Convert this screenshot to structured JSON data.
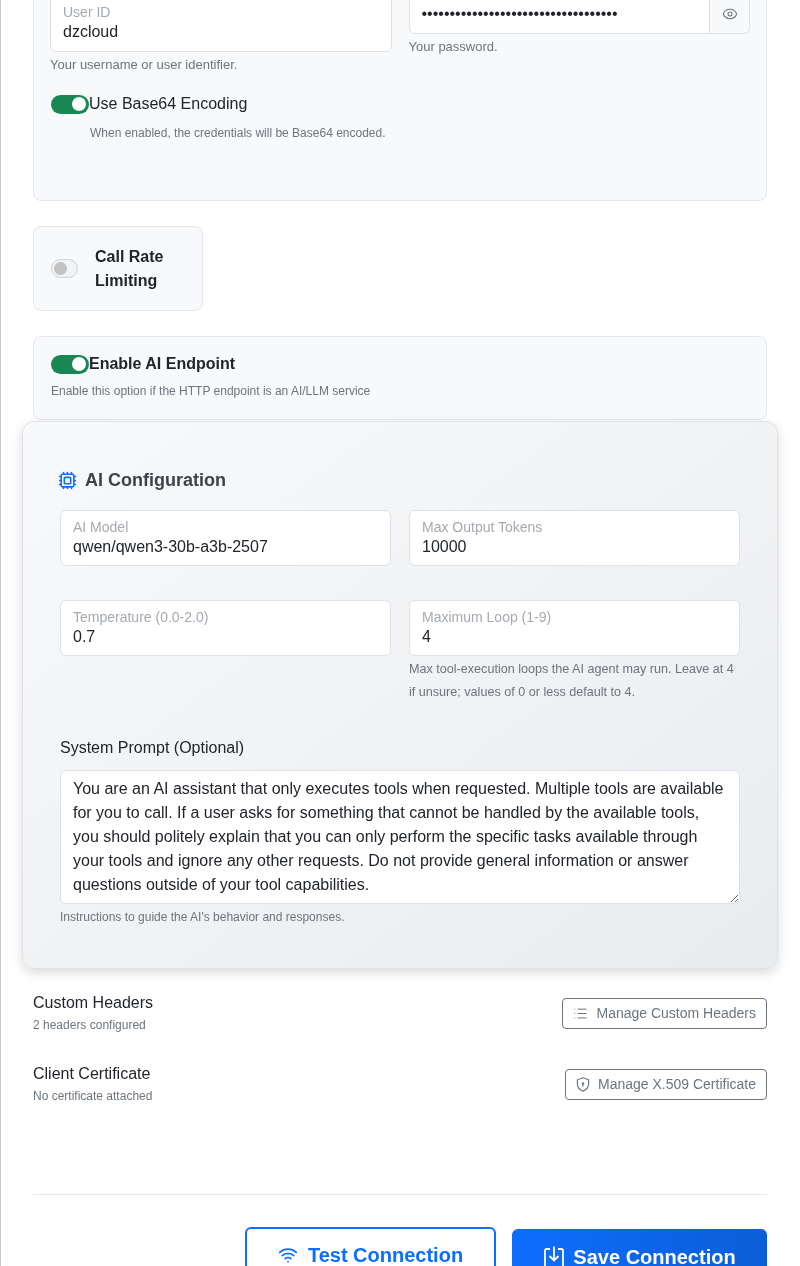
{
  "credentials": {
    "user": {
      "label": "User ID",
      "value": "dzcloud",
      "help": "Your username or user identifier."
    },
    "password": {
      "value": "•••••••••••••••••••••••••••••••••••",
      "help": "Your password."
    },
    "base64": {
      "label": "Use Base64 Encoding",
      "on": true,
      "description": "When enabled, the credentials will be Base64 encoded."
    }
  },
  "rate_limiting": {
    "label": "Call Rate Limiting",
    "on": false
  },
  "ai_endpoint": {
    "label": "Enable AI Endpoint",
    "on": true,
    "description": "Enable this option if the HTTP endpoint is an AI/LLM service"
  },
  "ai_configuration": {
    "title": "AI Configuration",
    "fields": [
      {
        "label": "AI Model",
        "value": "qwen/qwen3-30b-a3b-2507"
      },
      {
        "label": "Max Output Tokens",
        "value": "10000"
      },
      {
        "label": "Temperature (0.0-2.0)",
        "value": "0.7"
      },
      {
        "label": "Maximum Loop (1-9)",
        "value": "4",
        "help": "Max tool-execution loops the AI agent may run. Leave at 4 if unsure; values of 0 or less default to 4."
      }
    ],
    "system_prompt": {
      "label": "System Prompt (Optional)",
      "value": "You are an AI assistant that only executes tools when requested. Multiple tools are available for you to call. If a user asks for something that cannot be handled by the available tools, you should politely explain that you can only perform the specific tasks available through your tools and ignore any other requests. Do not provide general information or answer questions outside of your tool capabilities.",
      "help": "Instructions to guide the AI's behavior and responses."
    }
  },
  "attachments": [
    {
      "kind": "headers",
      "title": "Custom Headers",
      "status": "2 headers configured",
      "button": "Manage Custom Headers"
    },
    {
      "kind": "certificate",
      "title": "Client Certificate",
      "status": "No certificate attached",
      "button": "Manage X.509 Certificate"
    }
  ],
  "actions": [
    {
      "kind": "test",
      "label": "Test Connection"
    },
    {
      "kind": "save",
      "label": "Save Connection"
    }
  ]
}
